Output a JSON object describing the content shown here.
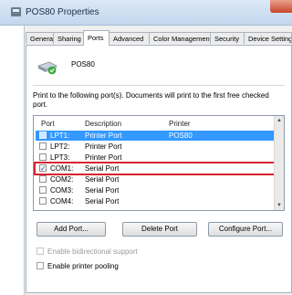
{
  "window": {
    "title": "POS80 Properties"
  },
  "tabs": [
    {
      "label": "General"
    },
    {
      "label": "Sharing"
    },
    {
      "label": "Ports"
    },
    {
      "label": "Advanced"
    },
    {
      "label": "Color Management"
    },
    {
      "label": "Security"
    },
    {
      "label": "Device Settings"
    }
  ],
  "active_tab": "Ports",
  "printer": {
    "name": "POS80"
  },
  "instructions": "Print to the following port(s). Documents will print to the first free checked port.",
  "port_list": {
    "columns": [
      "Port",
      "Description",
      "Printer"
    ],
    "rows": [
      {
        "port": "LPT1:",
        "description": "Printer Port",
        "printer": "POS80",
        "checked": false,
        "selected": true
      },
      {
        "port": "LPT2:",
        "description": "Printer Port",
        "printer": "",
        "checked": false,
        "selected": false
      },
      {
        "port": "LPT3:",
        "description": "Printer Port",
        "printer": "",
        "checked": false,
        "selected": false
      },
      {
        "port": "COM1:",
        "description": "Serial Port",
        "printer": "",
        "checked": true,
        "selected": false
      },
      {
        "port": "COM2:",
        "description": "Serial Port",
        "printer": "",
        "checked": false,
        "selected": false
      },
      {
        "port": "COM3:",
        "description": "Serial Port",
        "printer": "",
        "checked": false,
        "selected": false
      },
      {
        "port": "COM4:",
        "description": "Serial Port",
        "printer": "",
        "checked": false,
        "selected": false
      }
    ]
  },
  "buttons": {
    "add_port": "Add Port...",
    "delete_port": "Delete Port",
    "configure_port": "Configure Port..."
  },
  "options": {
    "bidirectional": {
      "label": "Enable bidirectional support",
      "checked": false,
      "enabled": false
    },
    "pooling": {
      "label": "Enable printer pooling",
      "checked": false,
      "enabled": true
    }
  },
  "colors": {
    "selection": "#3399ff",
    "highlight_box": "#d9212f"
  },
  "check_glyph": "✓"
}
